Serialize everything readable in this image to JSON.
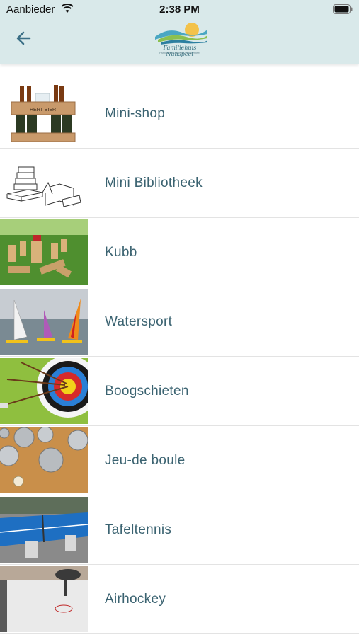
{
  "status_bar": {
    "carrier": "Aanbieder",
    "time": "2:38 PM"
  },
  "header": {
    "logo_text": "Familiehuis Nunspeet",
    "logo_subtext": "Familiehuis aan het Veluwemeer",
    "back_icon": "arrow-left-icon",
    "background": "#d9e9ea"
  },
  "items": [
    {
      "label": "Mini-shop",
      "image": "beer-crate"
    },
    {
      "label": "Mini Bibliotheek",
      "image": "books-sketch"
    },
    {
      "label": "Kubb",
      "image": "kubb-game"
    },
    {
      "label": "Watersport",
      "image": "sailing-boats"
    },
    {
      "label": "Boogschieten",
      "image": "archery-target"
    },
    {
      "label": "Jeu-de boule",
      "image": "petanque-balls"
    },
    {
      "label": "Tafeltennis",
      "image": "table-tennis"
    },
    {
      "label": "Airhockey",
      "image": "airhockey-table"
    }
  ],
  "colors": {
    "label": "#3b6371",
    "divider": "#e3e3e3"
  }
}
